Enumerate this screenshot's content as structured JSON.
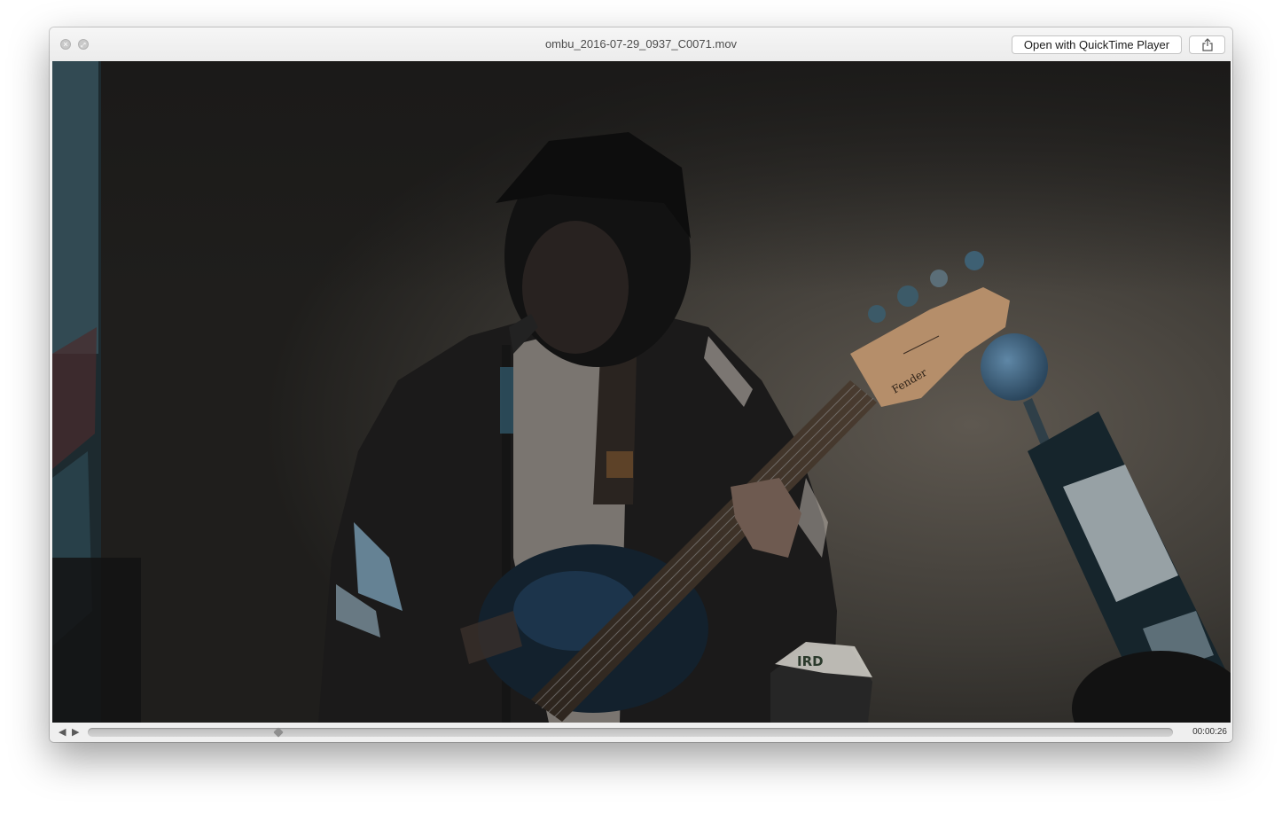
{
  "window": {
    "title": "ombu_2016-07-29_0937_C0071.mov"
  },
  "toolbar": {
    "open_with_label": "Open with QuickTime Player",
    "share_icon": "share-icon"
  },
  "traffic_lights": {
    "close_glyph": "×",
    "fullscreen_glyph": "⤢"
  },
  "video": {
    "content": "dimly lit live performance frame: bassist with Fender bass at microphone",
    "guitar_headstock_text": "Fender",
    "cap_text": "IRD"
  },
  "controls": {
    "rewind_glyph": "◀",
    "play_glyph": "▶",
    "progress": 0.176,
    "time_display": "00:00:26"
  },
  "colors": {
    "window_bg": "#f2f2f2",
    "video_bg": "#2a2825",
    "scrubber_track": "#c8c8c8",
    "scrubber_knob": "#8f8f8f"
  }
}
